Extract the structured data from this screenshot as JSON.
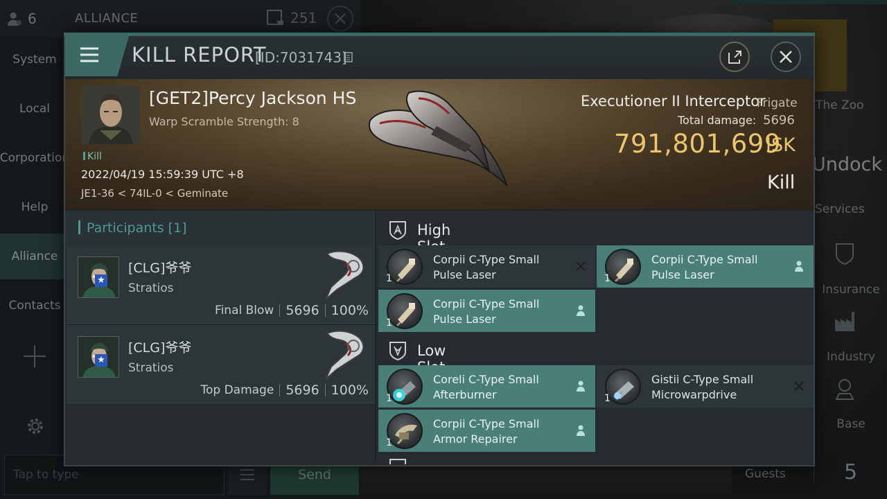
{
  "background": {
    "chat": {
      "member_count": "6",
      "channel_title": "ALLIANCE",
      "message_count": "251",
      "tabs": [
        {
          "label": "System"
        },
        {
          "label": "Local"
        },
        {
          "label": "Corporation"
        },
        {
          "label": "Help"
        },
        {
          "label": "Alliance"
        },
        {
          "label": "Contacts"
        }
      ],
      "input_placeholder": "Tap to type",
      "send_label": "Send"
    },
    "station": {
      "name": "The Zoo",
      "undock_label": "Undock",
      "services_label": "Services",
      "items": [
        {
          "label": "Insurance",
          "icon": "insurance-icon"
        },
        {
          "label": "Industry",
          "icon": "factory-icon"
        },
        {
          "label": "Base",
          "icon": "base-icon"
        }
      ],
      "guests_label": "Guests",
      "guests_count": "5"
    }
  },
  "report": {
    "title": "KILL REPORT",
    "id": "[ID:7031743]",
    "victim": {
      "name": "[GET2]Percy Jackson HS",
      "warp_scramble": "Warp Scramble Strength: 8",
      "tag": "Kill",
      "datetime": "2022/04/19 15:59:39 UTC +8",
      "location": "JE1-36 < 74IL-0 < Geminate"
    },
    "ship": {
      "name": "Executioner II Interceptor",
      "class": "Frigate",
      "total_damage_label": "Total damage:",
      "total_damage": "5696",
      "isk_value": "791,801,699",
      "isk_unit": "ISK",
      "result": "Kill"
    },
    "participants": {
      "title": "Participants [1]",
      "list": [
        {
          "name": "[CLG]爷爷",
          "ship": "Stratios",
          "role": "Final Blow",
          "damage": "5696",
          "percent": "100%"
        },
        {
          "name": "[CLG]爷爷",
          "ship": "Stratios",
          "role": "Top Damage",
          "damage": "5696",
          "percent": "100%"
        }
      ]
    },
    "fitting": {
      "high_slot": {
        "title": "High Slot",
        "modules": [
          {
            "name": "Corpii C-Type Small Pulse Laser",
            "qty": "1",
            "state": "destroyed",
            "icon": "pulse-laser-icon"
          },
          {
            "name": "Corpii C-Type Small Pulse Laser",
            "qty": "1",
            "state": "dropped",
            "icon": "pulse-laser-icon"
          },
          {
            "name": "Corpii C-Type Small Pulse Laser",
            "qty": "1",
            "state": "dropped",
            "icon": "pulse-laser-icon"
          }
        ]
      },
      "low_slot": {
        "title": "Low Slot",
        "modules": [
          {
            "name": "Coreli C-Type Small Afterburner",
            "qty": "1",
            "state": "dropped",
            "icon": "afterburner-icon"
          },
          {
            "name": "Gistii C-Type Small Microwarpdrive",
            "qty": "1",
            "state": "destroyed",
            "icon": "microwarpdrive-icon"
          },
          {
            "name": "Corpii C-Type Small Armor Repairer",
            "qty": "1",
            "state": "dropped",
            "icon": "armor-repairer-icon"
          }
        ]
      }
    }
  }
}
